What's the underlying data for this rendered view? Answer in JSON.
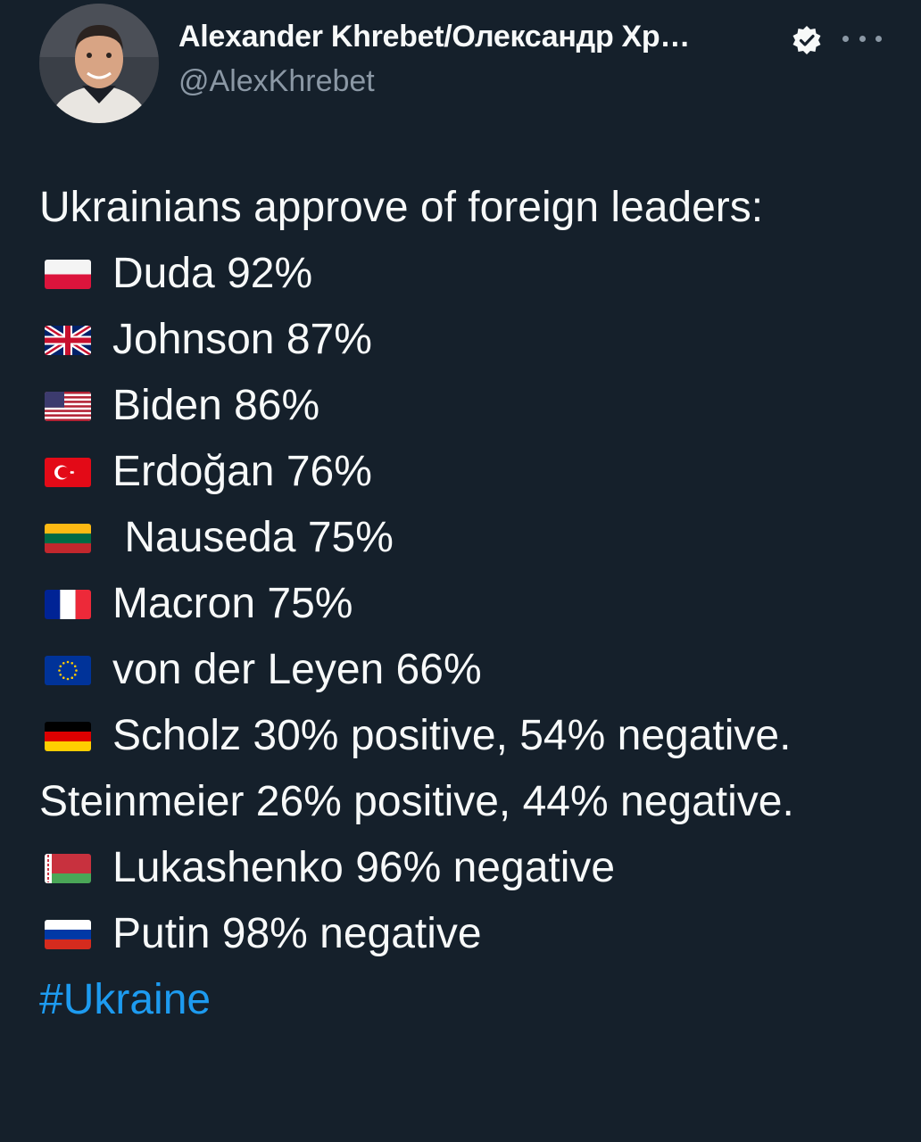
{
  "author": {
    "display_name": "Alexander Khrebet/Олександр Хр…",
    "handle": "@AlexKhrebet",
    "verified_icon": "verified-badge-icon",
    "more_icon": "more-options-icon"
  },
  "tweet": {
    "intro": "Ukrainians approve of foreign leaders:",
    "items": [
      {
        "flag": "poland-flag-icon",
        "text": "Duda 92%"
      },
      {
        "flag": "uk-flag-icon",
        "text": "Johnson 87%"
      },
      {
        "flag": "usa-flag-icon",
        "text": "Biden 86%"
      },
      {
        "flag": "turkey-flag-icon",
        "text": "Erdoğan 76%"
      },
      {
        "flag": "lithuania-flag-icon",
        "text": " Nauseda 75%"
      },
      {
        "flag": "france-flag-icon",
        "text": "Macron 75%"
      },
      {
        "flag": "eu-flag-icon",
        "text": "von der Leyen 66%"
      },
      {
        "flag": "germany-flag-icon",
        "text": "Scholz 30% positive, 54% negative. Steinmeier 26% positive, 44% negative."
      },
      {
        "flag": "belarus-flag-icon",
        "text": "Lukashenko 96% negative"
      },
      {
        "flag": "russia-flag-icon",
        "text": "Putin 98% negative"
      }
    ],
    "hashtag": "#Ukraine"
  },
  "colors": {
    "background": "#15202b",
    "text": "#f7f9f9",
    "secondary_text": "#8b98a5",
    "link": "#1d9bf0"
  }
}
